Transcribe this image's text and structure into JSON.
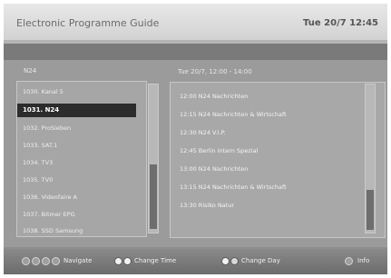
{
  "header": {
    "title": "Electronic Programme Guide",
    "datetime": "Tue 20/7 12:45"
  },
  "channel_list": {
    "header": "N24",
    "items": [
      {
        "label": "1030. Kanal 5"
      },
      {
        "label": "1031. N24",
        "selected": true
      },
      {
        "label": "1032. ProSieben"
      },
      {
        "label": "1033. SAT.1"
      },
      {
        "label": "1034. TV3"
      },
      {
        "label": "1035. TV0"
      },
      {
        "label": "1036. Videofaire A"
      },
      {
        "label": "1037. Bitmer EPG"
      },
      {
        "label": "1038. SSD Samsung"
      }
    ]
  },
  "schedule": {
    "header": "Tue 20/7,  12:00 - 14:00",
    "items": [
      "12:00 N24 Nachrichten",
      "12:15 N24 Nachrichten & Wirtschaft",
      "12:30 N24 V.I.P.",
      "12:45 Berlin Intern Spezial",
      "13:00 N24 Nachrichten",
      "13:15 N24 Nachrichten & Wirtschaft",
      "13:30 Risiko Natur"
    ]
  },
  "footer": {
    "navigate_label": "Navigate",
    "change_time_label": "Change Time",
    "change_day_label": "Change Day",
    "info_label": "Info"
  }
}
